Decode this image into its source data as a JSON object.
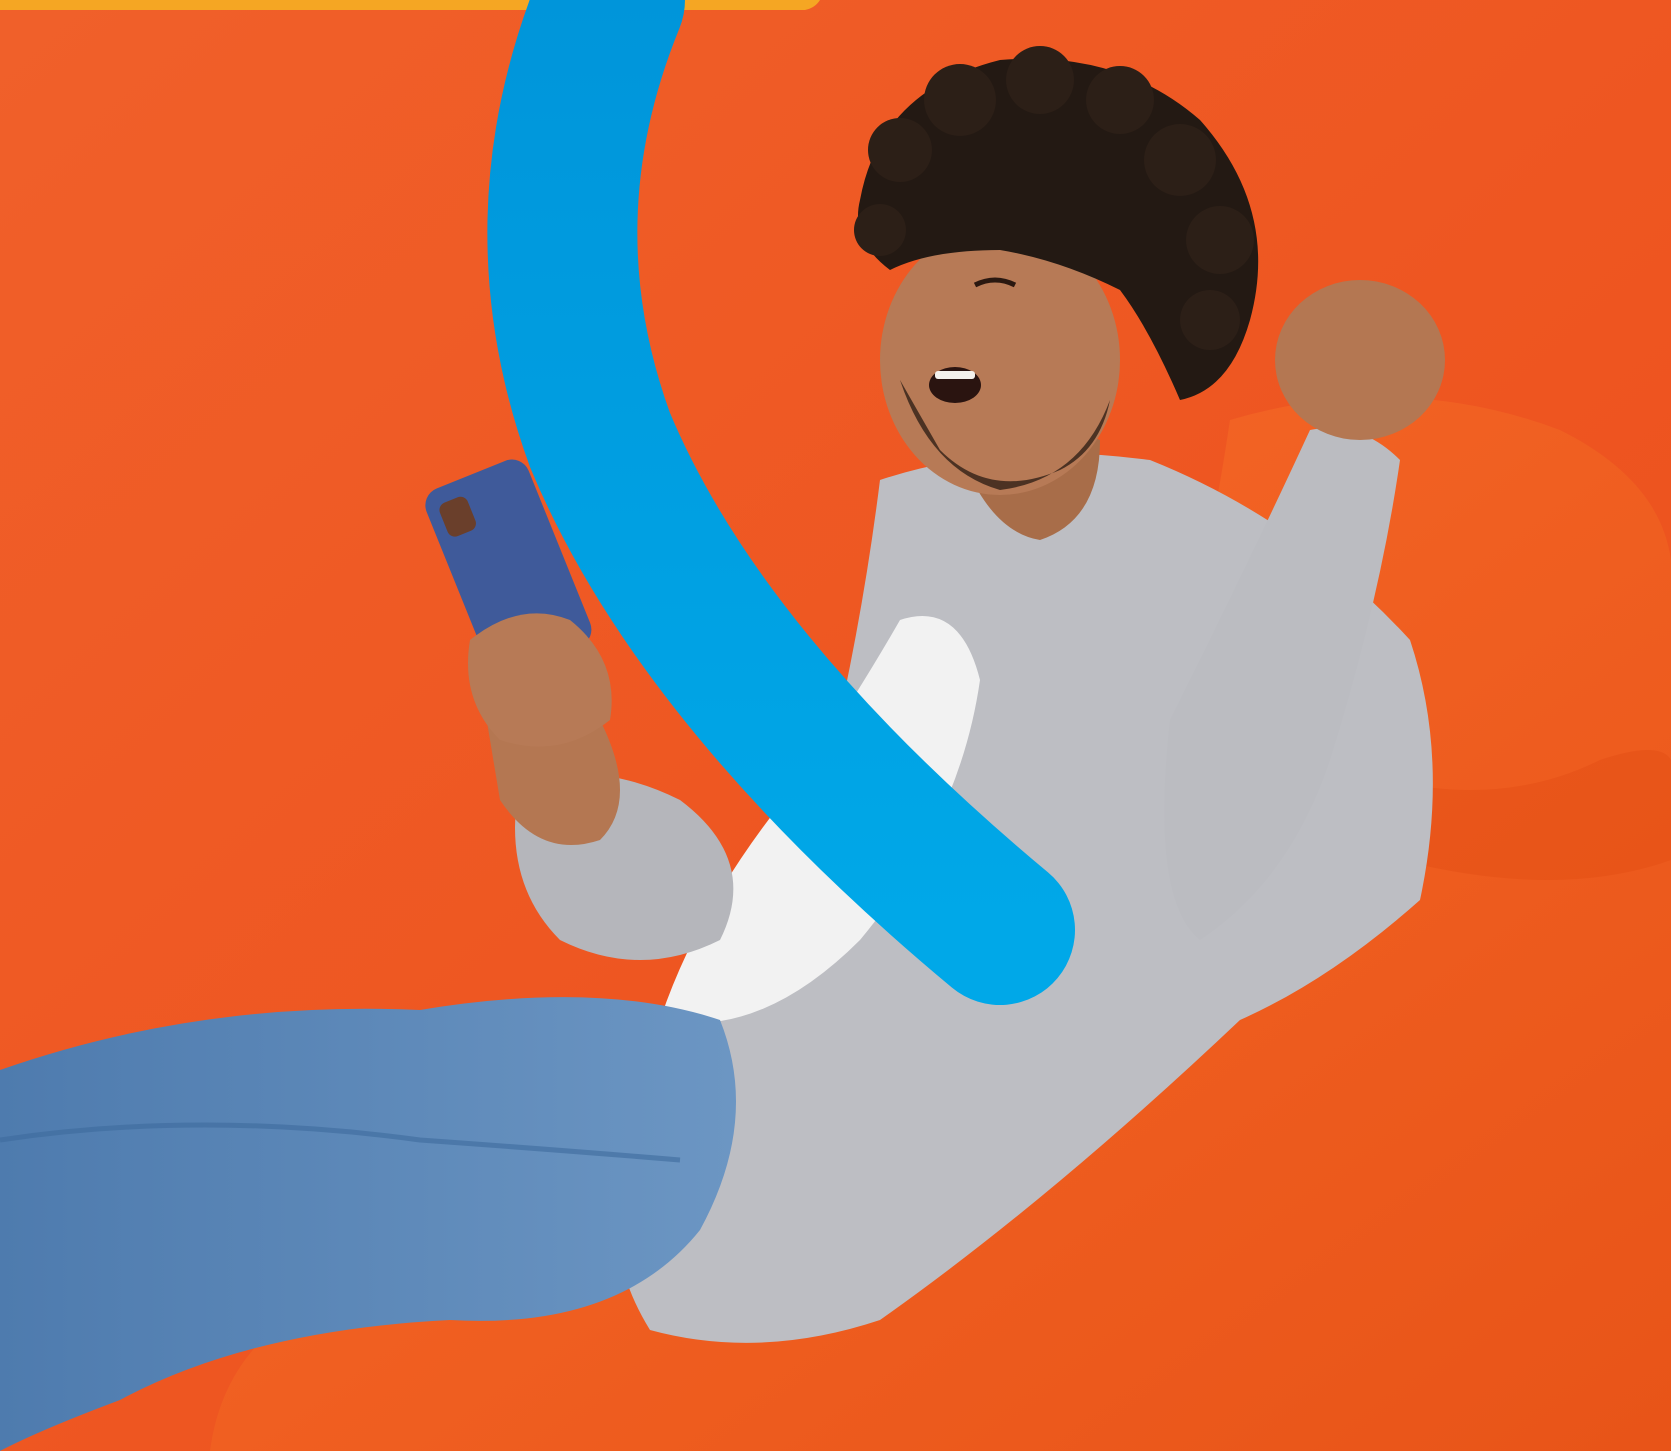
{
  "scene": {
    "description_icon": "promo-photo",
    "colors": {
      "background": "#F25A25",
      "accent_stripe": "#F5A623",
      "swoosh": "#009FE3",
      "beanbag": "#F45F1F",
      "shirt": "#BDBEC3",
      "jeans": "#5C86B5",
      "phone": "#3F5A9A",
      "skin": "#B77A56",
      "hair": "#231913"
    }
  }
}
